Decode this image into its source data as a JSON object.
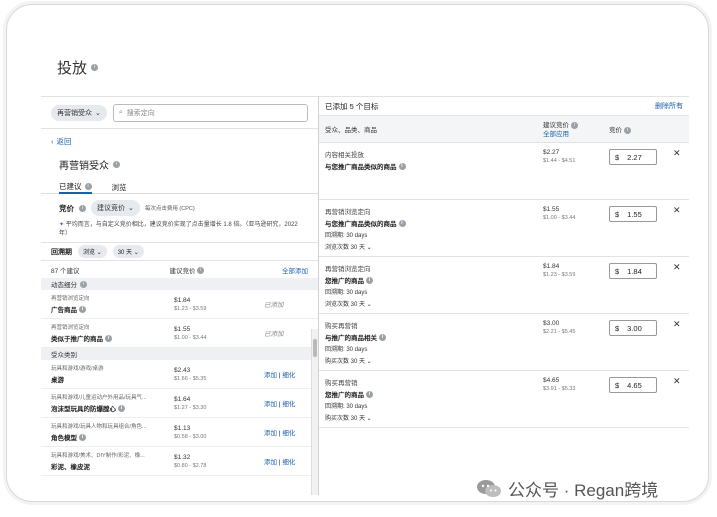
{
  "page_title": "投放",
  "left": {
    "audience_pill": "再营销受众",
    "search_placeholder": "搜索定向",
    "back_label": "返回",
    "section_title": "再营销受众",
    "tabs": [
      {
        "label": "已建议",
        "active": true
      },
      {
        "label": "浏览",
        "active": false
      }
    ],
    "bid_label": "竞价",
    "bid_select": "建议竞价",
    "bid_note": "每次点击费用 (CPC)",
    "tip": "平均而言，与自定义竞价相比，建议竞价实现了点击量增长 1.8 倍。（亚马逊研究，2022 年）",
    "lookback_label": "回溯期",
    "lookback_type": "浏览",
    "lookback_days": "30 天",
    "count_label": "87 个建议",
    "suggested_bid_header": "建议竞价",
    "add_all_label": "全部添加",
    "sections": [
      {
        "title": "动态细分",
        "rows": [
          {
            "sub": "再营销浏览定向",
            "name": "广告商品",
            "bid": "$1.84",
            "range": "$1.23 - $3.59",
            "status": "已添加",
            "actions": []
          },
          {
            "sub": "再营销浏览定向",
            "name": "类似于推广的商品",
            "bid": "$1.55",
            "range": "$1.00 - $3.44",
            "status": "已添加",
            "actions": []
          }
        ]
      },
      {
        "title": "受众类别",
        "rows": [
          {
            "sub": "",
            "name": "玩具和游戏/游戏/桌游",
            "bid": "$2.43",
            "range": "$1.66 - $5.35",
            "status": "",
            "actions": [
              "添加",
              "细化"
            ],
            "alt": "桌游"
          },
          {
            "sub": "玩具和游戏/儿童运动户外用品/玩具气...",
            "name": "泡沫型玩具的防爆膛心",
            "bid": "$1.64",
            "range": "$1.27 - $3.30",
            "status": "",
            "actions": [
              "添加",
              "细化"
            ]
          },
          {
            "sub": "玩具和游戏/玩具人物和玩具组合/角色...",
            "name": "角色模型",
            "bid": "$1.13",
            "range": "$0.58 - $3.00",
            "status": "",
            "actions": [
              "添加",
              "细化"
            ]
          },
          {
            "sub": "玩具和游戏/美术、DIY制作/彩泥、橡...",
            "name": "彩泥、橡皮泥",
            "bid": "$1.32",
            "range": "$0.80 - $2.78",
            "status": "",
            "actions": [
              "添加",
              "细化"
            ]
          }
        ]
      }
    ]
  },
  "right": {
    "added_label": "已添加 5 个目标",
    "remove_all": "删除所有",
    "col_target": "受众、品类、商品",
    "col_suggested": "建议竞价",
    "col_apply_all": "全部应用",
    "col_bid": "竞价",
    "rows": [
      {
        "line1": "内容相关投放",
        "line2": "与您推广商品类似的商品",
        "line3": "",
        "line4": "",
        "bid": "$2.27",
        "range": "$1.44 - $4.51",
        "currency": "$",
        "value": "2.27"
      },
      {
        "line1": "再营销浏览定向",
        "line2": "与您推广商品类似的商品",
        "line3": "回溯期: 30 days",
        "line4": "浏览次数 30 天",
        "bid": "$1.55",
        "range": "$1.00 - $3.44",
        "currency": "$",
        "value": "1.55"
      },
      {
        "line1": "再营销浏览定向",
        "line2": "您推广的商品",
        "line3": "回溯期: 30 days",
        "line4": "浏览次数 30 天",
        "bid": "$1.84",
        "range": "$1.23 - $3.59",
        "currency": "$",
        "value": "1.84"
      },
      {
        "line1": "购买再营销",
        "line2": "与推广的商品相关",
        "line3": "回溯期: 30 days",
        "line4": "购买次数 30 天",
        "bid": "$3.00",
        "range": "$2.21 - $5.45",
        "currency": "$",
        "value": "3.00"
      },
      {
        "line1": "购买再营销",
        "line2": "您推广的商品",
        "line3": "回溯期: 30 days",
        "line4": "购买次数 30 天",
        "bid": "$4.65",
        "range": "$3.91 - $5.33",
        "currency": "$",
        "value": "4.65"
      }
    ]
  },
  "watermark": "公众号 · Regan跨境",
  "colors": {
    "link": "#1a5fa8",
    "pill": "#e6e9ee",
    "header_bg": "#f4f5f7"
  }
}
